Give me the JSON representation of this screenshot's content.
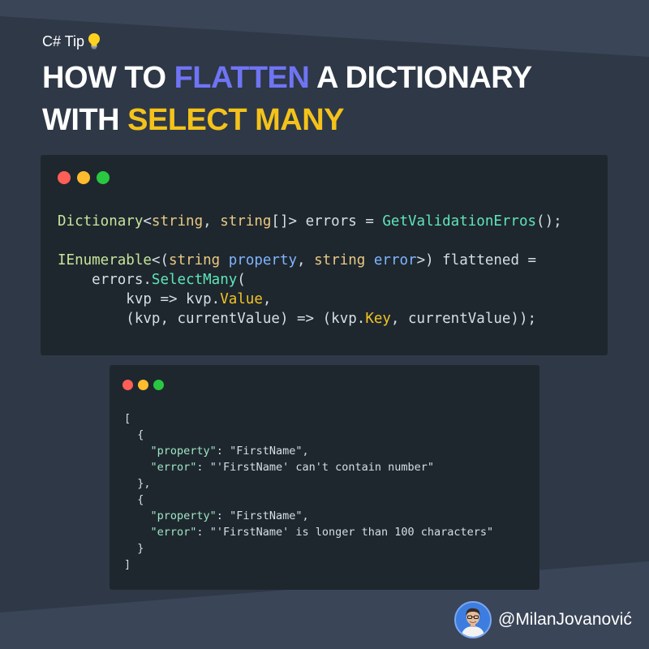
{
  "header": {
    "tip_label": "C# Tip",
    "headline": {
      "line1_pre": "HOW TO ",
      "line1_highlight": "FLATTEN",
      "line1_post": " A DICTIONARY",
      "line2_pre": "WITH ",
      "line2_highlight": "SELECT MANY"
    }
  },
  "colors": {
    "background": "#2e3847",
    "panel": "#1f272e",
    "highlight_blue": "#6f74f4",
    "highlight_yellow": "#f4c21a",
    "traffic_red": "#ff5f57",
    "traffic_yellow": "#febc2e",
    "traffic_green": "#28c840"
  },
  "code": {
    "line1": {
      "type": "Dictionary",
      "lt": "<",
      "kw1": "string",
      "mid1": ", ",
      "kw2": "string",
      "rest": "[]> errors = ",
      "call": "GetValidationErros",
      "end": "();"
    },
    "line2": {
      "type": "IEnumerable",
      "lt": "<(",
      "kw1": "string",
      "sp1": " ",
      "prop1": "property",
      "comma": ", ",
      "kw2": "string",
      "sp2": " ",
      "prop2": "error",
      "end": ">) flattened ="
    },
    "line3": {
      "indent": "    ",
      "obj": "errors.",
      "call": "SelectMany",
      "end": "("
    },
    "line4": {
      "indent": "        ",
      "pre": "kvp => kvp.",
      "prop": "Value",
      "end": ","
    },
    "line5": {
      "indent": "        ",
      "pre": "(kvp, currentValue) => (kvp.",
      "prop": "Key",
      "end": ", currentValue));"
    }
  },
  "json_output": {
    "open": "[",
    "obj_open": "  {",
    "key_property": "\"property\"",
    "key_error": "\"error\"",
    "sep": ": ",
    "entry1_property": "\"FirstName\"",
    "entry1_error": "\"'FirstName' can't contain number\"",
    "entry2_property": "\"FirstName\"",
    "entry2_error": "\"'FirstName' is longer than 100 characters\"",
    "obj_close_comma": "  },",
    "obj_close": "  }",
    "close": "]",
    "comma": ","
  },
  "author": {
    "handle": "@MilanJovanović",
    "avatar_icon": "person-avatar-icon"
  },
  "icons": {
    "tip": "lightbulb-icon"
  }
}
